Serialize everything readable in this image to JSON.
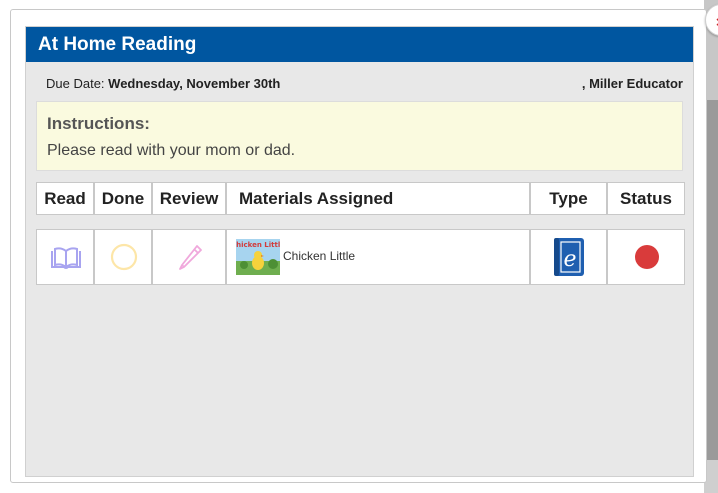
{
  "modal": {
    "close_glyph": "×",
    "title": "At Home Reading",
    "due_label": "Due Date: ",
    "due_value": "Wednesday, November 30th",
    "teacher": ", Miller Educator"
  },
  "instructions": {
    "title": "Instructions:",
    "text": "Please read with your mom or dad."
  },
  "table": {
    "headers": [
      "Read",
      "Done",
      "Review",
      "Materials Assigned",
      "Type",
      "Status"
    ],
    "rows": [
      {
        "read_icon": "open-book-icon",
        "done_icon": "empty-circle-icon",
        "review_icon": "pencil-icon",
        "thumbnail_text": "Chicken Little",
        "material": "Chicken Little",
        "type_icon": "ebook-icon",
        "type_glyph": "e",
        "status_icon": "status-dot-icon",
        "status_color": "#d93b3b"
      }
    ]
  },
  "colors": {
    "header_blue": "#0056a0",
    "instructions_bg": "#fafadf",
    "read_icon": "#a8a4f0",
    "done_icon": "#fde6a8",
    "review_icon": "#f0a8dc"
  }
}
